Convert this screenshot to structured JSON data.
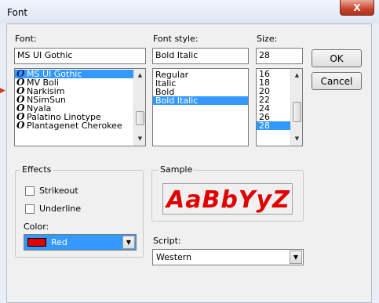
{
  "window": {
    "title": "Font",
    "close_label": "X"
  },
  "font": {
    "label": "Font:",
    "value": "MS UI Gothic",
    "items": [
      {
        "label": "MS UI Gothic",
        "selected": true
      },
      {
        "label": "MV Boli",
        "selected": false
      },
      {
        "label": "Narkisim",
        "selected": false
      },
      {
        "label": "NSimSun",
        "selected": false
      },
      {
        "label": "Nyala",
        "selected": false
      },
      {
        "label": "Palatino Linotype",
        "selected": false
      },
      {
        "label": "Plantagenet Cherokee",
        "selected": false
      }
    ],
    "item_icon": "O"
  },
  "style": {
    "label": "Font style:",
    "value": "Bold Italic",
    "items": [
      {
        "label": "Regular",
        "selected": false
      },
      {
        "label": "Italic",
        "selected": false
      },
      {
        "label": "Bold",
        "selected": false
      },
      {
        "label": "Bold Italic",
        "selected": true
      }
    ]
  },
  "size": {
    "label": "Size:",
    "value": "28",
    "items": [
      {
        "label": "16",
        "selected": false
      },
      {
        "label": "18",
        "selected": false
      },
      {
        "label": "20",
        "selected": false
      },
      {
        "label": "22",
        "selected": false
      },
      {
        "label": "24",
        "selected": false
      },
      {
        "label": "26",
        "selected": false
      },
      {
        "label": "28",
        "selected": true
      }
    ]
  },
  "buttons": {
    "ok": "OK",
    "cancel": "Cancel"
  },
  "effects": {
    "label": "Effects",
    "strikeout": "Strikeout",
    "underline": "Underline",
    "color_label": "Color:",
    "color_value": "Red",
    "color_swatch": "#e00000"
  },
  "sample": {
    "label": "Sample",
    "text": "AaBbYyZ"
  },
  "script": {
    "label": "Script:",
    "value": "Western"
  },
  "colors": {
    "selection": "#3399ff",
    "sample_text": "#e00000"
  }
}
